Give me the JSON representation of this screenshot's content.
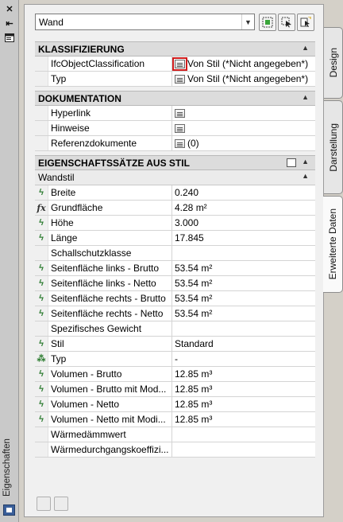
{
  "sidebar": {
    "title": "Eigenschaften"
  },
  "tabs": [
    {
      "label": "Design",
      "active": false
    },
    {
      "label": "Darstellung",
      "active": false
    },
    {
      "label": "Erweiterte Daten",
      "active": true
    }
  ],
  "header": {
    "object_type": "Wand"
  },
  "sections": {
    "klassifizierung": {
      "title": "KLASSIFIZIERUNG",
      "rows": [
        {
          "name": "IfcObjectClassification",
          "value": "Von Stil (*Nicht angegeben*)"
        },
        {
          "name": "Typ",
          "value": "Von Stil (*Nicht angegeben*)"
        }
      ]
    },
    "dokumentation": {
      "title": "DOKUMENTATION",
      "rows": [
        {
          "name": "Hyperlink",
          "value": ""
        },
        {
          "name": "Hinweise",
          "value": ""
        },
        {
          "name": "Referenzdokumente",
          "value": "(0)"
        }
      ]
    },
    "eigenschaftssaetze": {
      "title": "EIGENSCHAFTSSÄTZE AUS STIL",
      "subcategory": "Wandstil",
      "rows": [
        {
          "name": "Breite",
          "value": "0.240",
          "icon": "auto-property-icon"
        },
        {
          "name": "Grundfläche",
          "value": "4.28 m²",
          "icon": "formula-icon"
        },
        {
          "name": "Höhe",
          "value": "3.000",
          "icon": "auto-property-icon"
        },
        {
          "name": "Länge",
          "value": "17.845",
          "icon": "auto-property-icon"
        },
        {
          "name": "Schallschutzklasse",
          "value": "",
          "icon": ""
        },
        {
          "name": "Seitenfläche links - Brutto",
          "value": "53.54 m²",
          "icon": "auto-property-icon"
        },
        {
          "name": "Seitenfläche links - Netto",
          "value": "53.54 m²",
          "icon": "auto-property-icon"
        },
        {
          "name": "Seitenfläche rechts - Brutto",
          "value": "53.54 m²",
          "icon": "auto-property-icon"
        },
        {
          "name": "Seitenfläche rechts - Netto",
          "value": "53.54 m²",
          "icon": "auto-property-icon"
        },
        {
          "name": "Spezifisches Gewicht",
          "value": "",
          "icon": ""
        },
        {
          "name": "Stil",
          "value": "Standard",
          "icon": "auto-property-icon"
        },
        {
          "name": "Typ",
          "value": "-",
          "icon": "classification-icon"
        },
        {
          "name": "Volumen - Brutto",
          "value": "12.85 m³",
          "icon": "auto-property-icon"
        },
        {
          "name": "Volumen - Brutto mit Mod...",
          "value": "12.85 m³",
          "icon": "auto-property-icon"
        },
        {
          "name": "Volumen - Netto",
          "value": "12.85 m³",
          "icon": "auto-property-icon"
        },
        {
          "name": "Volumen - Netto mit Modi...",
          "value": "12.85 m³",
          "icon": "auto-property-icon"
        },
        {
          "name": "Wärmedämmwert",
          "value": "",
          "icon": ""
        },
        {
          "name": "Wärmedurchgangskoeffizi...",
          "value": "",
          "icon": ""
        }
      ]
    }
  },
  "colors": {
    "highlight": "#d01c1c",
    "auto_icon": "#2e7d32"
  }
}
